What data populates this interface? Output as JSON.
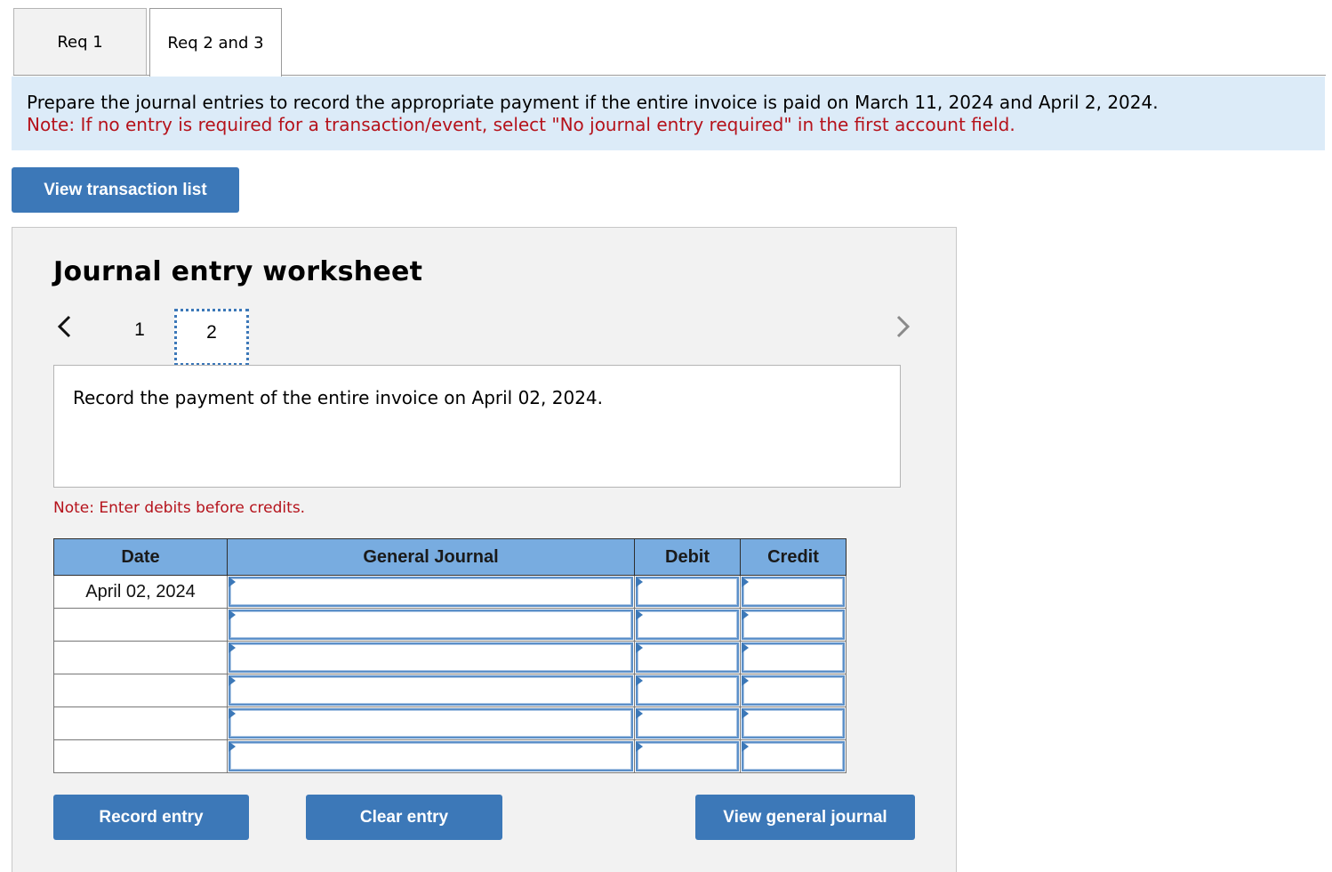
{
  "tabs": [
    {
      "label": "Req 1",
      "active": false
    },
    {
      "label": "Req 2 and 3",
      "active": true
    }
  ],
  "instructions": {
    "text": "Prepare the journal entries to record the appropriate payment if the entire invoice is paid on March 11, 2024 and April 2, 2024.",
    "note": "Note: If no entry is required for a transaction/event, select \"No journal entry required\" in the first account field."
  },
  "buttons": {
    "view_transaction_list": "View transaction list",
    "record_entry": "Record entry",
    "clear_entry": "Clear entry",
    "view_general_journal": "View general journal"
  },
  "worksheet": {
    "title": "Journal entry worksheet",
    "pages": [
      "1",
      "2"
    ],
    "current_page": "2",
    "description": "Record the payment of the entire invoice on April 02, 2024.",
    "note": "Note: Enter debits before credits."
  },
  "journal": {
    "headers": [
      "Date",
      "General Journal",
      "Debit",
      "Credit"
    ],
    "rows": [
      {
        "date": "April 02, 2024",
        "account": "",
        "debit": "",
        "credit": ""
      },
      {
        "date": "",
        "account": "",
        "debit": "",
        "credit": ""
      },
      {
        "date": "",
        "account": "",
        "debit": "",
        "credit": ""
      },
      {
        "date": "",
        "account": "",
        "debit": "",
        "credit": ""
      },
      {
        "date": "",
        "account": "",
        "debit": "",
        "credit": ""
      },
      {
        "date": "",
        "account": "",
        "debit": "",
        "credit": ""
      }
    ]
  },
  "colors": {
    "accent": "#3c78b8",
    "header_bg": "#78ace0",
    "banner_bg": "#dcebf8",
    "note_red": "#b5121b",
    "panel_bg": "#f2f2f2"
  },
  "icons": {
    "prev": "chevron-left-icon",
    "next": "chevron-right-icon"
  }
}
